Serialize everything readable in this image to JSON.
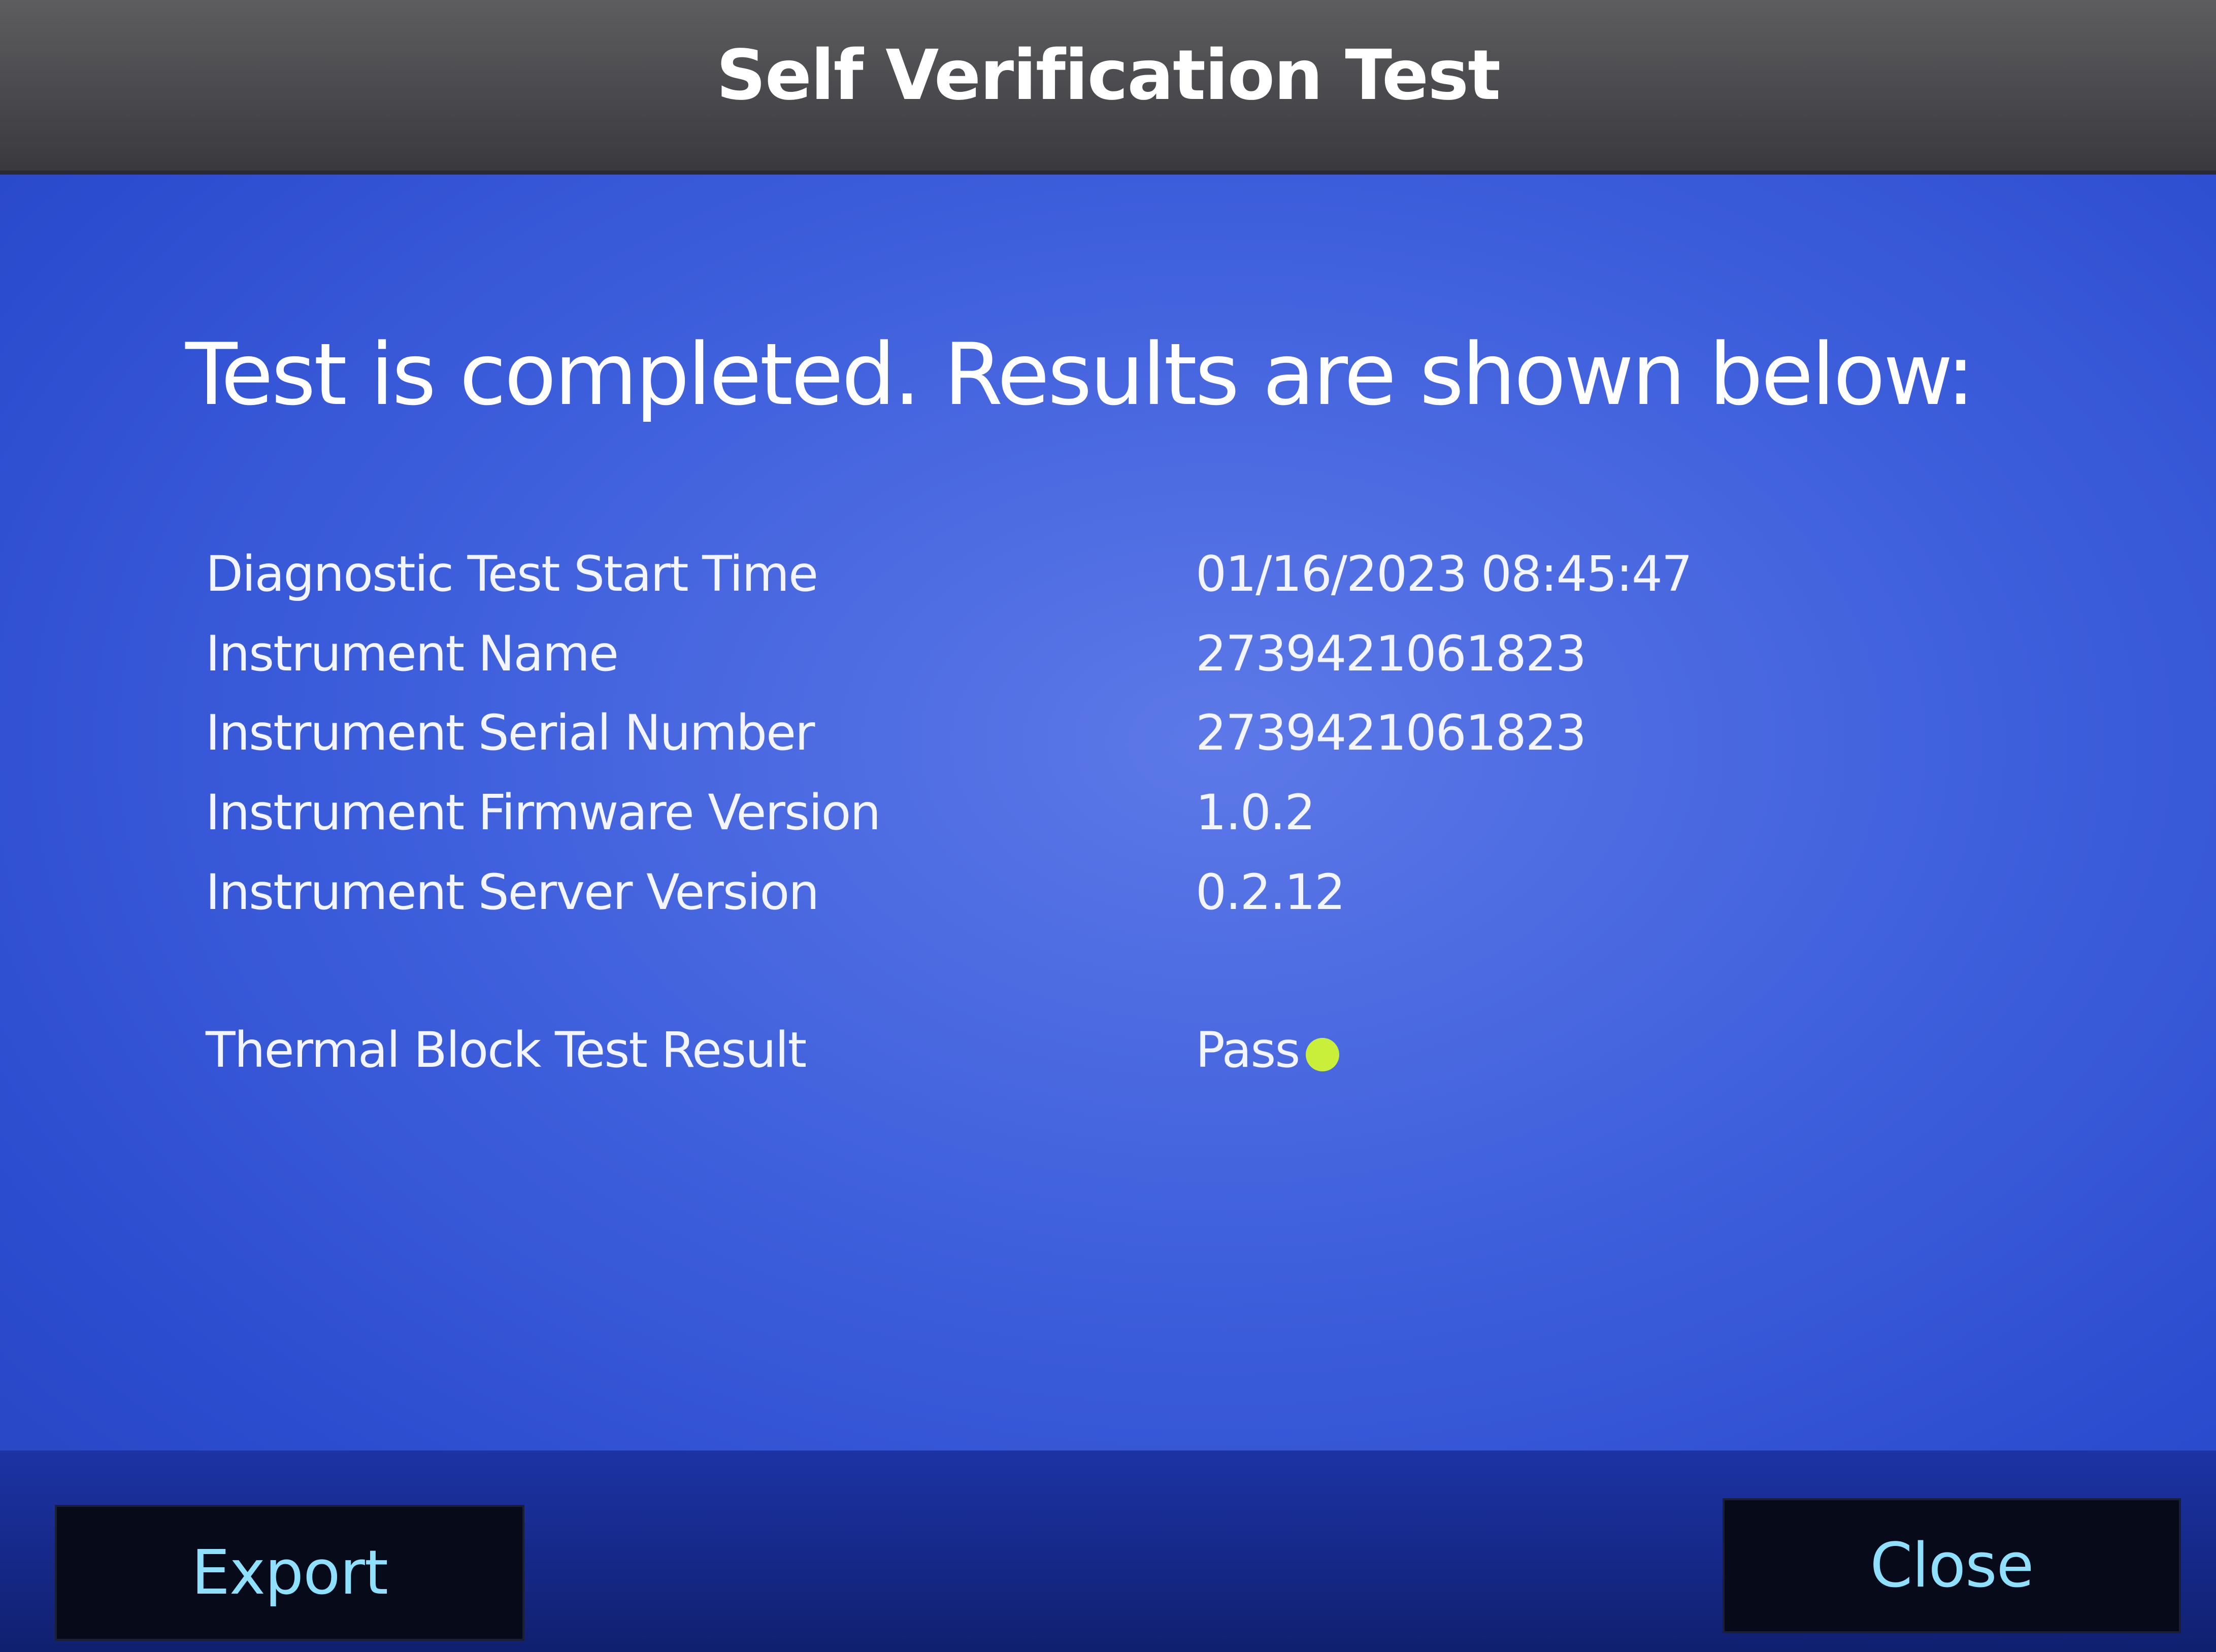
{
  "header": {
    "title": "Self Verification Test"
  },
  "main": {
    "headline": "Test is completed. Results are shown below:",
    "info_rows": [
      {
        "label": "Diagnostic Test Start Time",
        "value": "01/16/2023 08:45:47"
      },
      {
        "label": "Instrument Name",
        "value": "2739421061823"
      },
      {
        "label": "Instrument Serial Number",
        "value": "2739421061823"
      },
      {
        "label": "Instrument Firmware Version",
        "value": "1.0.2"
      },
      {
        "label": "Instrument Server Version",
        "value": "0.2.12"
      }
    ],
    "result_row": {
      "label": "Thermal Block Test Result",
      "value": "Pass",
      "status_icon": "status-dot-icon",
      "status_color": "#c9ef3a"
    }
  },
  "footer": {
    "export_label": "Export",
    "close_label": "Close"
  },
  "colors": {
    "background": "#3e5fdc",
    "title_bar": "#4a4a4e",
    "button_bg": "#070a18",
    "button_text": "#8fe0ff"
  }
}
